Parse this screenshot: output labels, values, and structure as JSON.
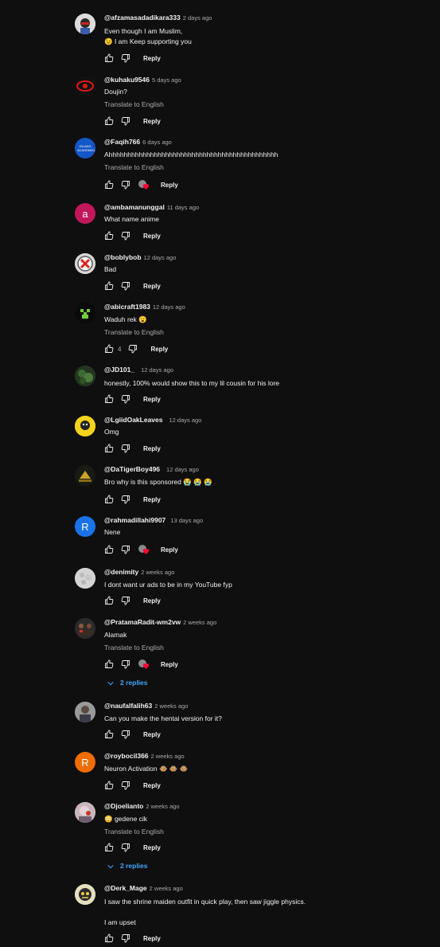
{
  "icons": {
    "like": "thumb-up-icon",
    "dislike": "thumb-down-icon",
    "heart": "creator-heart-icon",
    "replies_toggle": "chevron-down-icon"
  },
  "colors": {
    "background": "#0f0f0f",
    "text": "#f1f1f1",
    "muted": "#aaaaaa",
    "link": "#3ea6ff",
    "heart": "#ff0033"
  },
  "comments": [
    {
      "author": "@afzamasadadikara333",
      "time": "2 days ago",
      "lines": [
        "Even though I am Muslim,",
        "😉 I am Keep supporting you"
      ],
      "reply_label": "Reply"
    },
    {
      "author": "@kuhaku9546",
      "time": "5 days ago",
      "lines": [
        "Doujin?"
      ],
      "translate": "Translate to English",
      "reply_label": "Reply"
    },
    {
      "author": "@Faqih766",
      "time": "6 days ago",
      "lines": [
        "Ahhhhhhhhhhhhhhhhhhhhhhhhhhhhhhhhhhhhhhhhhhhhh"
      ],
      "translate": "Translate to English",
      "reply_label": "Reply",
      "avatar_text": "GILANG ACADEMIKU"
    },
    {
      "author": "@ambamanunggal",
      "time": "11 days ago",
      "lines": [
        "What name anime"
      ],
      "reply_label": "Reply",
      "avatar_letter": "a"
    },
    {
      "author": "@boblybob",
      "time": "12 days ago",
      "lines": [
        "Bad"
      ],
      "reply_label": "Reply"
    },
    {
      "author": "@abicraft1983",
      "time": "12 days ago",
      "lines": [
        "Waduh rek 😮"
      ],
      "translate": "Translate to English",
      "reply_label": "Reply",
      "likes": "4"
    },
    {
      "author": "@JD101_",
      "time": "12 days ago",
      "lines": [
        "honestly, 100% would show this to my lil cousin for his lore"
      ],
      "reply_label": "Reply"
    },
    {
      "author": "@LgiidOakLeaves",
      "time": "12 days ago",
      "lines": [
        "Omg"
      ],
      "reply_label": "Reply"
    },
    {
      "author": "@DaTigerBoy496",
      "time": "12 days ago",
      "lines": [
        "Bro why is this sponsored 😭 😭 😭"
      ],
      "reply_label": "Reply"
    },
    {
      "author": "@rahmadillahi9907",
      "time": "13 days ago",
      "lines": [
        "Nene"
      ],
      "reply_label": "Reply",
      "avatar_letter": "R"
    },
    {
      "author": "@denimity",
      "time": "2 weeks ago",
      "lines": [
        "I dont want ur ads to be in my YouTube fyp"
      ],
      "reply_label": "Reply"
    },
    {
      "author": "@PratamaRadit-wm2vw",
      "time": "2 weeks ago",
      "lines": [
        "Alamak"
      ],
      "translate": "Translate to English",
      "reply_label": "Reply",
      "replies": "2 replies"
    },
    {
      "author": "@naufalfalih63",
      "time": "2 weeks ago",
      "lines": [
        "Can you make the hentai version for it?"
      ],
      "reply_label": "Reply"
    },
    {
      "author": "@roybocil366",
      "time": "2 weeks ago",
      "lines": [
        "Neuron Activation 🐵 🐵 🐵"
      ],
      "reply_label": "Reply",
      "avatar_letter": "R"
    },
    {
      "author": "@Djoelianto",
      "time": "2 weeks ago",
      "lines": [
        "😳 gedene cik"
      ],
      "translate": "Translate to English",
      "reply_label": "Reply",
      "replies": "2 replies"
    },
    {
      "author": "@Derk_Mage",
      "time": "2 weeks ago",
      "lines": [
        "I saw the shrine maiden outfit in quick play, then saw jiggle physics.",
        "",
        "I am upset"
      ],
      "reply_label": "Reply"
    }
  ]
}
